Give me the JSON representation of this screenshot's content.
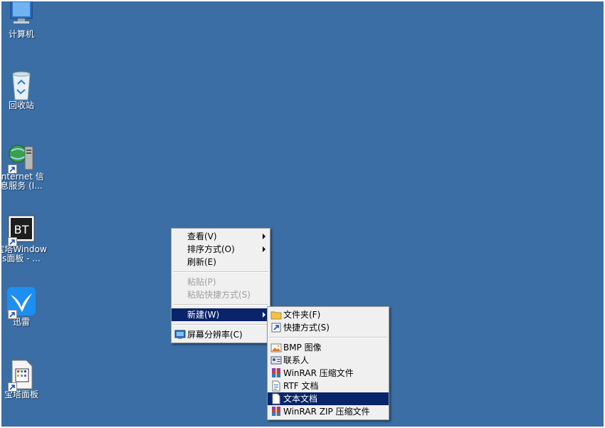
{
  "desktop": {
    "icons": [
      {
        "label": "计算机"
      },
      {
        "label": "回收站"
      },
      {
        "label": "Internet 信息服务 (I..."
      },
      {
        "label": "宝塔Windows面板 - ..."
      },
      {
        "label": "迅雷"
      },
      {
        "label": "宝塔面板"
      }
    ]
  },
  "context_menu": {
    "items": [
      {
        "label": "查看(V)"
      },
      {
        "label": "排序方式(O)"
      },
      {
        "label": "刷新(E)"
      },
      {
        "label": "粘贴(P)"
      },
      {
        "label": "粘贴快捷方式(S)"
      },
      {
        "label": "新建(W)"
      },
      {
        "label": "屏幕分辨率(C)"
      }
    ]
  },
  "new_submenu": {
    "items": [
      {
        "label": "文件夹(F)"
      },
      {
        "label": "快捷方式(S)"
      },
      {
        "label": "BMP 图像"
      },
      {
        "label": "联系人"
      },
      {
        "label": "WinRAR 压缩文件"
      },
      {
        "label": "RTF 文档"
      },
      {
        "label": "文本文档"
      },
      {
        "label": "WinRAR ZIP 压缩文件"
      }
    ]
  },
  "colors": {
    "desktop_bg": "#3a6ea5",
    "menu_bg": "#f0f0f0",
    "highlight": "#0a246a"
  }
}
